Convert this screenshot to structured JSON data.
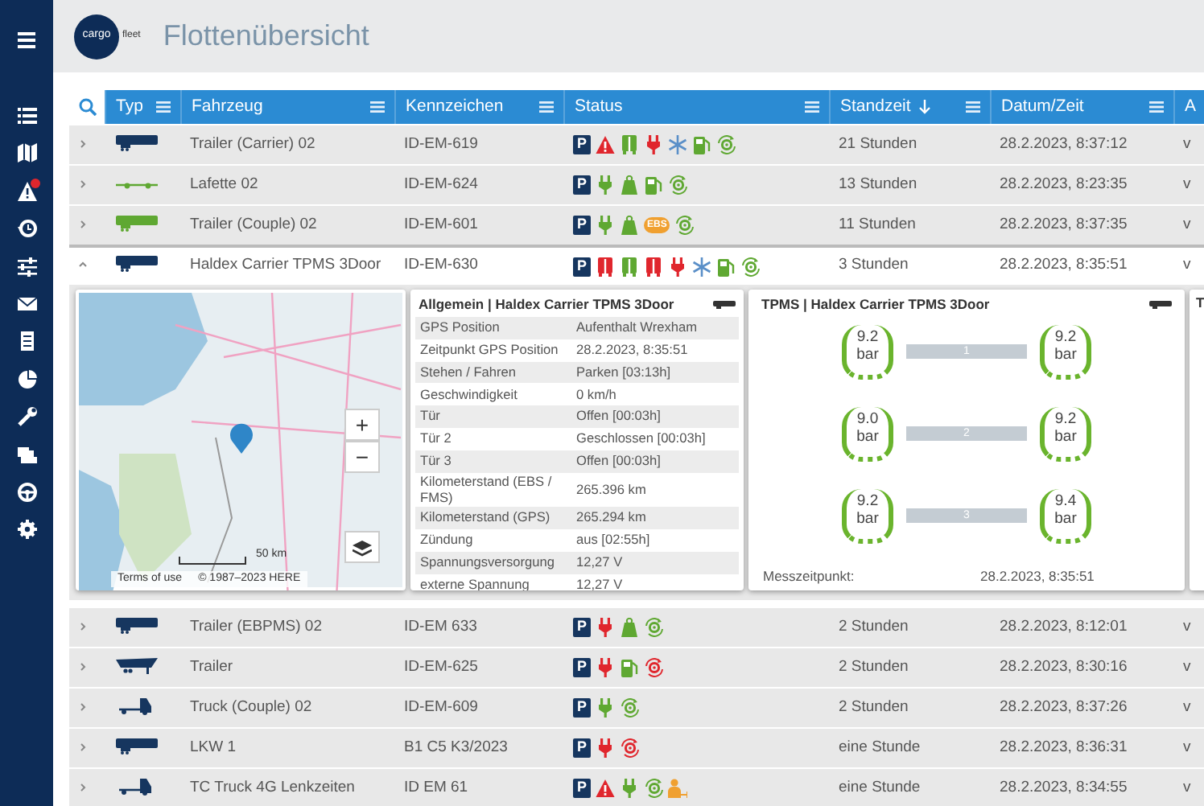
{
  "app": {
    "logo_text_1": "cargo",
    "logo_text_2": "fleet",
    "title": "Flottenübersicht"
  },
  "sidebar": [
    {
      "kind": "list",
      "notification": false
    },
    {
      "kind": "map",
      "notification": false
    },
    {
      "kind": "alert",
      "notification": true
    },
    {
      "kind": "history",
      "notification": false
    },
    {
      "kind": "sliders",
      "notification": false
    },
    {
      "kind": "mail",
      "notification": false
    },
    {
      "kind": "document",
      "notification": false
    },
    {
      "kind": "chart",
      "notification": false
    },
    {
      "kind": "wrench",
      "notification": false
    },
    {
      "kind": "trucks",
      "notification": false
    },
    {
      "kind": "wheel",
      "notification": false
    },
    {
      "kind": "settings",
      "notification": false
    }
  ],
  "table": {
    "columns": [
      {
        "label": "Typ",
        "sorted": false
      },
      {
        "label": "Fahrzeug",
        "sorted": false
      },
      {
        "label": "Kennzeichen",
        "sorted": false
      },
      {
        "label": "Status",
        "sorted": false
      },
      {
        "label": "Standzeit",
        "sorted": true
      },
      {
        "label": "Datum/Zeit",
        "sorted": false
      },
      {
        "label": "A",
        "sorted": false
      }
    ],
    "rows": [
      {
        "expanded": false,
        "vehicle": {
          "kind": "trailer",
          "color": "#16365f"
        },
        "name": "Trailer (Carrier) 02",
        "plate": "ID-EM-619",
        "status": [
          {
            "kind": "parking",
            "label": "P"
          },
          {
            "kind": "warning",
            "color": "#e0262d"
          },
          {
            "kind": "door",
            "color": "#5fa832"
          },
          {
            "kind": "plug",
            "color": "#e0262d"
          },
          {
            "kind": "snow",
            "color": "#5a8fc8"
          },
          {
            "kind": "fuel",
            "color": "#5fa832"
          },
          {
            "kind": "tire",
            "color": "#5fa832"
          }
        ],
        "standzeit": "21 Stunden",
        "datetime": "28.2.2023, 8:37:12",
        "column_8": "v"
      },
      {
        "expanded": false,
        "vehicle": {
          "kind": "flatbed",
          "color": "#5fa832"
        },
        "name": "Lafette 02",
        "plate": "ID-EM-624",
        "status": [
          {
            "kind": "parking",
            "label": "P"
          },
          {
            "kind": "plug",
            "color": "#5fa832"
          },
          {
            "kind": "weight",
            "color": "#5fa832"
          },
          {
            "kind": "fuel",
            "color": "#5fa832"
          },
          {
            "kind": "tire",
            "color": "#5fa832"
          }
        ],
        "standzeit": "13 Stunden",
        "datetime": "28.2.2023, 8:23:35",
        "column_8": "v"
      },
      {
        "expanded": false,
        "vehicle": {
          "kind": "trailer",
          "color": "#5fa832"
        },
        "name": "Trailer (Couple) 02",
        "plate": "ID-EM-601",
        "status": [
          {
            "kind": "parking",
            "label": "P"
          },
          {
            "kind": "plug",
            "color": "#5fa832"
          },
          {
            "kind": "weight",
            "color": "#5fa832"
          },
          {
            "kind": "ebs",
            "label": "EBS",
            "color": "#f0a030"
          },
          {
            "kind": "tire",
            "color": "#5fa832"
          }
        ],
        "standzeit": "11 Stunden",
        "datetime": "28.2.2023, 8:37:35",
        "column_8": "v"
      },
      {
        "expanded": true,
        "vehicle": {
          "kind": "trailer",
          "color": "#16365f"
        },
        "name": "Haldex Carrier TPMS 3Door",
        "plate": "ID-EM-630",
        "status": [
          {
            "kind": "parking",
            "label": "P"
          },
          {
            "kind": "door",
            "color": "#e0262d"
          },
          {
            "kind": "door",
            "color": "#5fa832"
          },
          {
            "kind": "door",
            "color": "#e0262d"
          },
          {
            "kind": "plug",
            "color": "#e0262d"
          },
          {
            "kind": "snow",
            "color": "#5a8fc8"
          },
          {
            "kind": "fuel",
            "color": "#5fa832"
          },
          {
            "kind": "tire",
            "color": "#5fa832"
          }
        ],
        "standzeit": "3 Stunden",
        "datetime": "28.2.2023, 8:35:51",
        "column_8": "v"
      },
      {
        "expanded": false,
        "vehicle": {
          "kind": "trailer",
          "color": "#16365f"
        },
        "name": "Trailer (EBPMS) 02",
        "plate": "ID-EM 633",
        "status": [
          {
            "kind": "parking",
            "label": "P"
          },
          {
            "kind": "plug",
            "color": "#e0262d"
          },
          {
            "kind": "weight",
            "color": "#5fa832"
          },
          {
            "kind": "tire",
            "color": "#5fa832"
          }
        ],
        "standzeit": "2 Stunden",
        "datetime": "28.2.2023, 8:12:01",
        "column_8": "v"
      },
      {
        "expanded": false,
        "vehicle": {
          "kind": "tipper",
          "color": "#16365f"
        },
        "name": "Trailer",
        "plate": "ID-EM-625",
        "status": [
          {
            "kind": "parking",
            "label": "P"
          },
          {
            "kind": "plug",
            "color": "#e0262d"
          },
          {
            "kind": "fuel",
            "color": "#5fa832"
          },
          {
            "kind": "tire",
            "color": "#e0262d"
          }
        ],
        "standzeit": "2 Stunden",
        "datetime": "28.2.2023, 8:30:16",
        "column_8": "v"
      },
      {
        "expanded": false,
        "vehicle": {
          "kind": "truck",
          "color": "#16365f"
        },
        "name": "Truck (Couple) 02",
        "plate": "ID-EM-609",
        "status": [
          {
            "kind": "parking",
            "label": "P"
          },
          {
            "kind": "plug",
            "color": "#5fa832"
          },
          {
            "kind": "tire",
            "color": "#5fa832"
          }
        ],
        "standzeit": "2 Stunden",
        "datetime": "28.2.2023, 8:37:26",
        "column_8": "v"
      },
      {
        "expanded": false,
        "vehicle": {
          "kind": "trailer",
          "color": "#16365f"
        },
        "name": "LKW 1",
        "plate": "B1 C5 K3/2023",
        "status": [
          {
            "kind": "parking",
            "label": "P"
          },
          {
            "kind": "plug",
            "color": "#e0262d"
          },
          {
            "kind": "tire",
            "color": "#e0262d"
          }
        ],
        "standzeit": "eine Stunde",
        "datetime": "28.2.2023, 8:36:31",
        "column_8": "v"
      },
      {
        "expanded": false,
        "vehicle": {
          "kind": "truck",
          "color": "#16365f"
        },
        "name": "TC Truck 4G Lenkzeiten",
        "plate": "ID EM 61",
        "status": [
          {
            "kind": "parking",
            "label": "P"
          },
          {
            "kind": "warning",
            "color": "#e0262d"
          },
          {
            "kind": "plug",
            "color": "#5fa832"
          },
          {
            "kind": "tire",
            "color": "#5fa832"
          },
          {
            "kind": "driver",
            "color": "#f0a030"
          }
        ],
        "standzeit": "eine Stunde",
        "datetime": "28.2.2023, 8:34:55",
        "column_8": "v"
      }
    ],
    "detail_panel": {
      "map": {
        "zoom_in": "+",
        "zoom_out": "−",
        "scale": "50 km",
        "terms": "Terms of use",
        "copyright": "© 1987–2023 HERE"
      },
      "general": {
        "title": "Allgemein | Haldex Carrier TPMS 3Door",
        "rows": [
          {
            "key": "GPS Position",
            "value": "Aufenthalt Wrexham"
          },
          {
            "key": "Zeitpunkt GPS Position",
            "value": "28.2.2023, 8:35:51"
          },
          {
            "key": "Stehen / Fahren",
            "value": "Parken [03:13h]"
          },
          {
            "key": "Geschwindigkeit",
            "value": "0 km/h"
          },
          {
            "key": "Tür",
            "value": "Offen [00:03h]"
          },
          {
            "key": "Tür 2",
            "value": "Geschlossen [00:03h]"
          },
          {
            "key": "Tür 3",
            "value": "Offen [00:03h]"
          },
          {
            "key": "Kilometerstand (EBS / FMS)",
            "value": "265.396 km"
          },
          {
            "key": "Kilometerstand (GPS)",
            "value": "265.294 km"
          },
          {
            "key": "Zündung",
            "value": "aus [02:55h]"
          },
          {
            "key": "Spannungsversorgung",
            "value": "12,27 V"
          },
          {
            "key": "externe Spannung",
            "value": "12,27 V"
          }
        ]
      },
      "tpms": {
        "title": "TPMS | Haldex Carrier TPMS 3Door",
        "axles": [
          {
            "label": "1",
            "left": {
              "value": "9.2",
              "unit": "bar"
            },
            "right": {
              "value": "9.2",
              "unit": "bar"
            }
          },
          {
            "label": "2",
            "left": {
              "value": "9.0",
              "unit": "bar"
            },
            "right": {
              "value": "9.2",
              "unit": "bar"
            }
          },
          {
            "label": "3",
            "left": {
              "value": "9.2",
              "unit": "bar"
            },
            "right": {
              "value": "9.4",
              "unit": "bar"
            }
          }
        ],
        "timestamp_label": "Messzeitpunkt:",
        "timestamp": "28.2.2023, 8:35:51"
      },
      "next_card": {
        "title": "T"
      }
    }
  }
}
